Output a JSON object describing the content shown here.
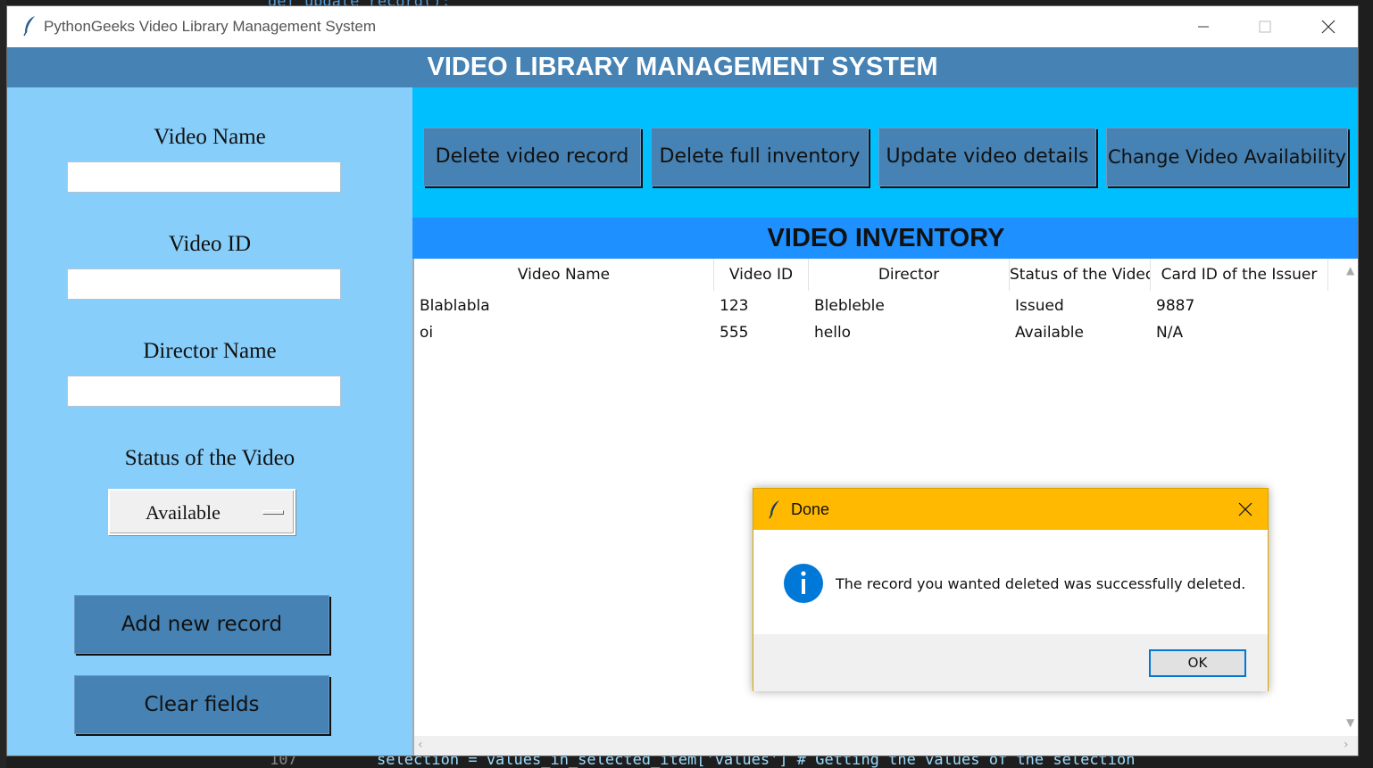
{
  "window": {
    "title": "PythonGeeks Video Library Management System"
  },
  "header": {
    "title": "VIDEO LIBRARY MANAGEMENT SYSTEM"
  },
  "form": {
    "video_name_label": "Video Name",
    "video_name_value": "",
    "video_id_label": "Video ID",
    "video_id_value": "",
    "director_label": "Director Name",
    "director_value": "",
    "status_label": "Status of the Video",
    "status_value": "Available",
    "add_button": "Add new record",
    "clear_button": "Clear fields"
  },
  "actions": {
    "delete_record": "Delete video record",
    "delete_inventory": "Delete full inventory",
    "update_details": "Update video details",
    "change_availability": "Change Video Availability"
  },
  "inventory": {
    "title": "VIDEO INVENTORY",
    "columns": [
      "Video Name",
      "Video ID",
      "Director",
      "Status of the Videc",
      "Card ID of the Issuer"
    ],
    "rows": [
      [
        "Blablabla",
        "123",
        "Blebleble",
        "Issued",
        "9887"
      ],
      [
        "oi",
        "555",
        "hello",
        "Available",
        "N/A"
      ]
    ]
  },
  "dialog": {
    "title": "Done",
    "message": "The record you wanted deleted was successfully deleted.",
    "ok_button": "OK"
  },
  "background": {
    "code_top": "def update_record():",
    "line_number": "107",
    "code_bottom": "selection = values_in_selected_item['values'] # Getting the values of the selection"
  },
  "colors": {
    "header_bg": "#4682b4",
    "left_panel_bg": "#87cefa",
    "right_panel_bg": "#00bfff",
    "inventory_title_bg": "#1e90ff",
    "dialog_title_bg": "#ffb900",
    "info_icon": "#0078d7"
  },
  "icons": {
    "app": "feather-icon",
    "info": "info-icon"
  }
}
